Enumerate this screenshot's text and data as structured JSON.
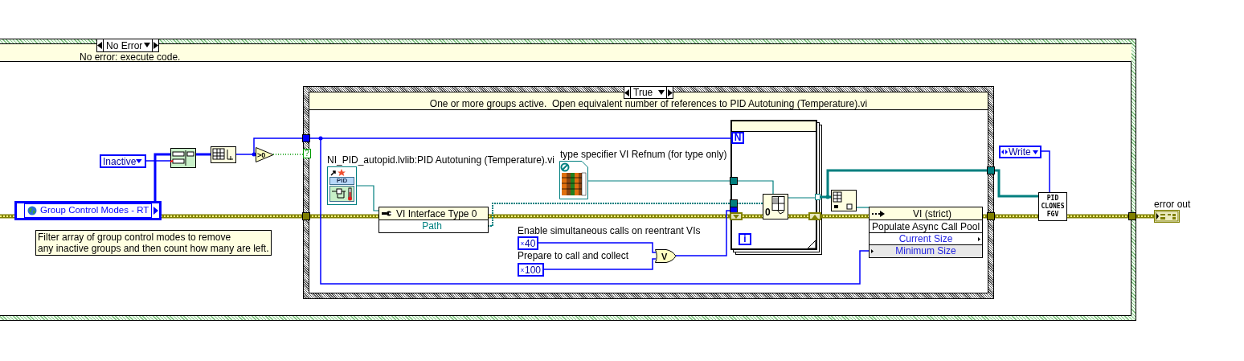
{
  "outer_case": {
    "selector": "No Error",
    "subdiagram_label": "No error: execute code."
  },
  "enum_constant": {
    "value": "Inactive"
  },
  "global_variable": {
    "name": "Group Control Modes - RT"
  },
  "comment": [
    "Filter array of group control modes to remove",
    "any inactive groups and then count how many are left."
  ],
  "compare_node": {
    "text": ">0"
  },
  "selector_terminal": "?",
  "inner_case": {
    "selector": "True",
    "subdiagram_label": "One or more groups active.  Open equivalent number of references to PID Autotuning (Temperature).vi"
  },
  "vi_constant": {
    "label": "NI_PID_autopid.lvlib:PID Autotuning (Temperature).vi",
    "icon_text": "PID"
  },
  "property_node": {
    "class": "VI Interface Type 0",
    "property": "Path"
  },
  "refnum_constant": {
    "label": "type specifier VI Refnum (for type only)"
  },
  "numeric_constants": [
    {
      "label": "Enable simultaneous calls on reentrant VIs",
      "radix": "x",
      "value": "40"
    },
    {
      "label": "Prepare to call and collect",
      "radix": "x",
      "value": "100"
    }
  ],
  "or_gate": {
    "symbol": "V"
  },
  "for_loop": {
    "count_terminal": "N",
    "iteration_terminal": "i"
  },
  "open_reference_node": {
    "text": "0"
  },
  "invoke_node": {
    "class": "VI (strict)",
    "method": "Populate Async Call Pool",
    "parameters": [
      {
        "name": "Current Size",
        "kind": "output"
      },
      {
        "name": "Minimum Size",
        "kind": "input"
      }
    ]
  },
  "write_enum": {
    "value": "Write"
  },
  "fgv_subvi": {
    "lines": [
      "PID",
      "CLONES",
      "FGV"
    ]
  },
  "error_out": {
    "label": "error out"
  }
}
